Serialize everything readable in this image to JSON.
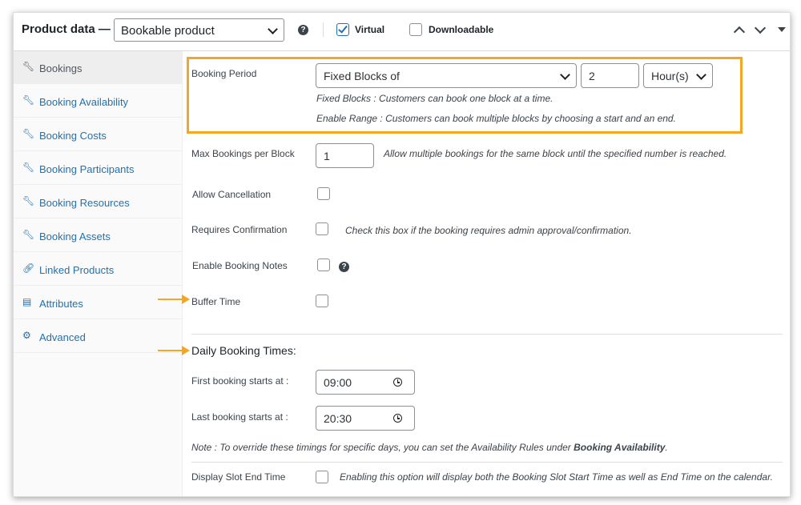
{
  "header": {
    "title": "Product data —",
    "product_type": "Bookable product",
    "virtual_label": "Virtual",
    "virtual_checked": true,
    "downloadable_label": "Downloadable",
    "downloadable_checked": false
  },
  "sidebar": {
    "items": [
      {
        "label": "Bookings",
        "icon": "wrench-icon",
        "active": true
      },
      {
        "label": "Booking Availability",
        "icon": "wrench-icon"
      },
      {
        "label": "Booking Costs",
        "icon": "wrench-icon"
      },
      {
        "label": "Booking Participants",
        "icon": "wrench-icon"
      },
      {
        "label": "Booking Resources",
        "icon": "wrench-icon"
      },
      {
        "label": "Booking Assets",
        "icon": "wrench-icon"
      },
      {
        "label": "Linked Products",
        "icon": "link-icon"
      },
      {
        "label": "Attributes",
        "icon": "list-icon"
      },
      {
        "label": "Advanced",
        "icon": "gear-icon"
      }
    ]
  },
  "booking_period": {
    "label": "Booking Period",
    "type_value": "Fixed Blocks of",
    "block_value": "2",
    "unit_value": "Hour(s)",
    "desc_fixed": "Fixed Blocks : Customers can book one block at a time.",
    "desc_range": "Enable Range : Customers can book multiple blocks by choosing a start and an end."
  },
  "max_bookings": {
    "label": "Max Bookings per Block",
    "value": "1",
    "desc": "Allow multiple bookings for the same block until the specified number is reached."
  },
  "allow_cancellation": {
    "label": "Allow Cancellation"
  },
  "requires_confirmation": {
    "label": "Requires Confirmation",
    "desc": "Check this box if the booking requires admin approval/confirmation."
  },
  "enable_notes": {
    "label": "Enable Booking Notes"
  },
  "buffer_time": {
    "label": "Buffer Time"
  },
  "daily_times": {
    "heading": "Daily Booking Times:",
    "first_label": "First booking starts at :",
    "first_value": "09:00",
    "last_label": "Last booking starts at :",
    "last_value": "20:30",
    "note_prefix": "Note : To override these timings for specific days, you can set the Availability Rules under ",
    "note_link": "Booking Availability",
    "note_suffix": "."
  },
  "display_slot_end": {
    "label": "Display Slot End Time",
    "desc": "Enabling this option will display both the Booking Slot Start Time as well as End Time on the calendar."
  },
  "colors": {
    "accent": "#2271b1",
    "highlight": "#f5a623"
  }
}
